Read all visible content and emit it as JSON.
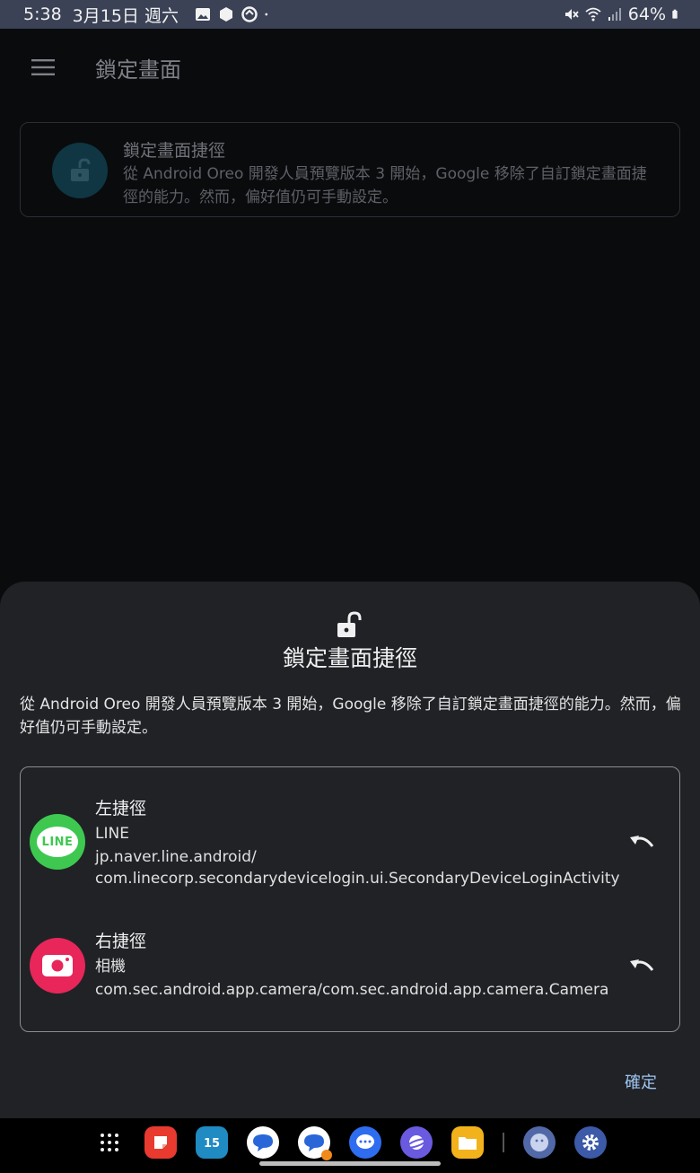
{
  "status_bar": {
    "time": "5:38",
    "date": "3月15日 週六",
    "battery": "64%",
    "icons": [
      "gallery-icon",
      "hexagon-app-icon",
      "sync-app-icon",
      "dot-icon",
      "mute-icon",
      "wifi-icon",
      "signal-icon",
      "battery-icon"
    ]
  },
  "app_bar": {
    "title": "鎖定畫面",
    "menu_icon": "hamburger-menu-icon"
  },
  "card": {
    "title": "鎖定畫面捷徑",
    "description": "從 Android Oreo 開發人員預覽版本 3 開始，Google 移除了自訂鎖定畫面捷徑的能力。然而，偏好值仍可手動設定。",
    "icon": "unlock-icon"
  },
  "sheet": {
    "title": "鎖定畫面捷徑",
    "description": "從 Android Oreo 開發人員預覽版本 3 開始，Google 移除了自訂鎖定畫面捷徑的能力。然而，偏好值仍可手動設定。",
    "icon": "unlock-icon",
    "shortcuts": [
      {
        "label": "左捷徑",
        "app": "LINE",
        "component": "jp.naver.line.android/\ncom.linecorp.secondarydevicelogin.ui.SecondaryDeviceLoginActivity",
        "badge_text": "LINE",
        "color": "#3ec850"
      },
      {
        "label": "右捷徑",
        "app": "相機",
        "component": "com.sec.android.app.camera/com.sec.android.app.camera.Camera",
        "color": "#e8265a"
      }
    ],
    "confirm_label": "確定"
  },
  "taskbar": {
    "apps": [
      "app-drawer-icon",
      "samsung-notes-icon",
      "calendar-icon",
      "messages-icon",
      "messages-alt-icon",
      "chat-icon",
      "internet-browser-icon",
      "my-files-icon",
      "recent-app-icon",
      "settings-icon"
    ],
    "calendar_day": "15"
  },
  "colors": {
    "accent": "#9ec5f0",
    "sheet_bg": "#202226",
    "status_bar_bg": "#3b4256"
  }
}
